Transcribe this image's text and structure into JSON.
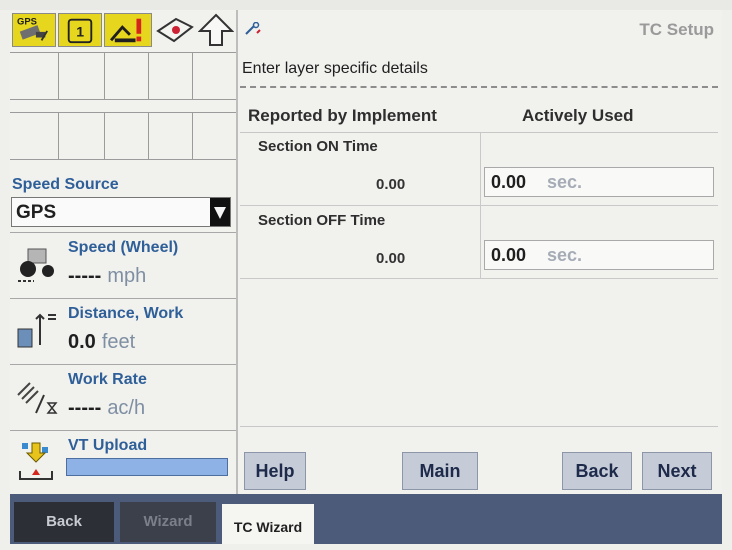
{
  "status_icons": {
    "gps_label": "GPS",
    "implement_number": "1",
    "items": [
      "gps-antenna-icon",
      "implement-icon",
      "alert-icon",
      "guidance-icon",
      "up-arrow-icon"
    ]
  },
  "speed_source": {
    "label": "Speed Source",
    "selected": "GPS"
  },
  "metrics": [
    {
      "title": "Speed (Wheel)",
      "value": "-----",
      "unit": "mph",
      "icon": "tractor-icon"
    },
    {
      "title": "Distance, Work",
      "value": "0.0",
      "unit": "feet",
      "icon": "distance-icon"
    },
    {
      "title": "Work Rate",
      "value": "-----",
      "unit": "ac/h",
      "icon": "work-rate-icon"
    },
    {
      "title": "VT Upload",
      "value": "",
      "unit": "",
      "icon": "vt-upload-icon"
    }
  ],
  "bottom": {
    "back_label": "Back",
    "wizard_label": "Wizard",
    "tab_label": "TC Wizard"
  },
  "panel": {
    "title": "TC Setup",
    "subtitle": "Enter layer specific details",
    "col_reported": "Reported by Implement",
    "col_active": "Actively Used",
    "rows": [
      {
        "label": "Section ON Time",
        "reported": "0.00",
        "active_value": "0.00",
        "unit": "sec."
      },
      {
        "label": "Section OFF Time",
        "reported": "0.00",
        "active_value": "0.00",
        "unit": "sec."
      }
    ],
    "buttons": {
      "help": "Help",
      "main": "Main",
      "back": "Back",
      "next": "Next"
    }
  },
  "colors": {
    "accent_blue": "#2f5f98",
    "bottom_strip": "#4c5b7a",
    "button_bg": "#c6cbd8",
    "status_yellow": "#e6d61e"
  }
}
